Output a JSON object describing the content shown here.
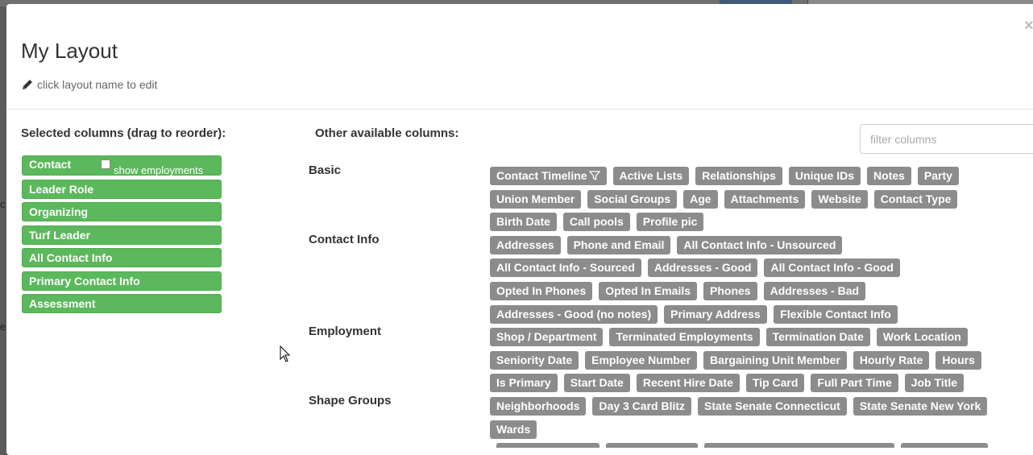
{
  "backdrop": {
    "left_chars": [
      "c",
      "e"
    ]
  },
  "modal": {
    "title": "My Layout",
    "edit_hint": "click layout name to edit",
    "close_glyph": "×"
  },
  "selected": {
    "heading": "Selected columns (drag to reorder):",
    "items": [
      "Contact",
      "Leader Role",
      "Organizing",
      "Turf Leader",
      "All Contact Info",
      "Primary Contact Info",
      "Assessment"
    ],
    "show_employments_label": "show employments",
    "show_employments_checked": false
  },
  "available": {
    "heading": "Other available columns:",
    "filter_placeholder": "filter columns",
    "groups": [
      {
        "label": "Basic",
        "rows": [
          [
            "Contact Timeline",
            "Active Lists",
            "Relationships",
            "Unique IDs",
            "Notes",
            "Party"
          ],
          [
            "Union Member",
            "Social Groups",
            "Age",
            "Attachments",
            "Website",
            "Contact Type"
          ],
          [
            "Birth Date",
            "Call pools",
            "Profile pic"
          ]
        ]
      },
      {
        "label": "Contact Info",
        "rows": [
          [
            "Addresses",
            "Phone and Email",
            "All Contact Info - Unsourced"
          ],
          [
            "All Contact Info - Sourced",
            "Addresses - Good",
            "All Contact Info - Good"
          ],
          [
            "Opted In Phones",
            "Opted In Emails",
            "Phones",
            "Addresses - Bad"
          ],
          [
            "Addresses - Good (no notes)",
            "Primary Address",
            "Flexible Contact Info"
          ]
        ]
      },
      {
        "label": "Employment",
        "rows": [
          [
            "Shop / Department",
            "Terminated Employments",
            "Termination Date",
            "Work Location"
          ],
          [
            "Seniority Date",
            "Employee Number",
            "Bargaining Unit Member",
            "Hourly Rate",
            "Hours"
          ],
          [
            "Is Primary",
            "Start Date",
            "Recent Hire Date",
            "Tip Card",
            "Full Part Time",
            "Job Title"
          ]
        ]
      },
      {
        "label": "Shape Groups",
        "rows": [
          [
            "Neighborhoods",
            "Day 3 Card Blitz",
            "State Senate Connecticut",
            "State Senate New York"
          ],
          [
            "Wards"
          ]
        ]
      }
    ]
  },
  "colors": {
    "selected_tag": "#5cb85c",
    "available_tag": "#8c8c8c"
  },
  "icons": {
    "edit": "pencil-icon",
    "filter": "funnel-icon",
    "close": "close-icon",
    "pointer": "cursor-icon"
  }
}
